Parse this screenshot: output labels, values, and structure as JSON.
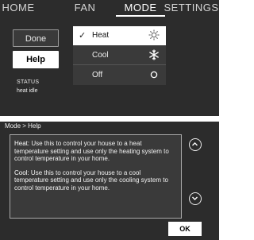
{
  "mode_screen": {
    "tabs": [
      {
        "label": "HOME",
        "active": false
      },
      {
        "label": "FAN",
        "active": false
      },
      {
        "label": "MODE",
        "active": true
      },
      {
        "label": "SETTINGS",
        "active": false
      }
    ],
    "done_label": "Done",
    "help_label": "Help",
    "status_label": "STATUS",
    "status_value": "heat idle",
    "mode_options": [
      {
        "check": "✓",
        "label": "Heat",
        "icon": "sun-icon",
        "selected": true
      },
      {
        "check": "",
        "label": "Cool",
        "icon": "snowflake-icon",
        "selected": false
      },
      {
        "check": "",
        "label": "Off",
        "icon": "circle-off-icon",
        "selected": false
      }
    ]
  },
  "help_screen": {
    "breadcrumb": "Mode > Help",
    "paragraphs": [
      {
        "term": "Heat:",
        "text": " Use this to control your house to a heat temperature setting and use only the heating system to control temperature in your home."
      },
      {
        "term": "Cool:",
        "text": " Use this to control your house to a cool temperature setting and use only the cooling system to control temperature in your home."
      }
    ],
    "scroll_up_icon": "chevron-up-icon",
    "scroll_down_icon": "chevron-down-icon",
    "ok_label": "OK"
  },
  "colors": {
    "screen_bg": "#2c2c2c",
    "panel_bg": "#3a3a3a",
    "selected_bg": "#ffffff",
    "text": "#f2f2f2"
  }
}
